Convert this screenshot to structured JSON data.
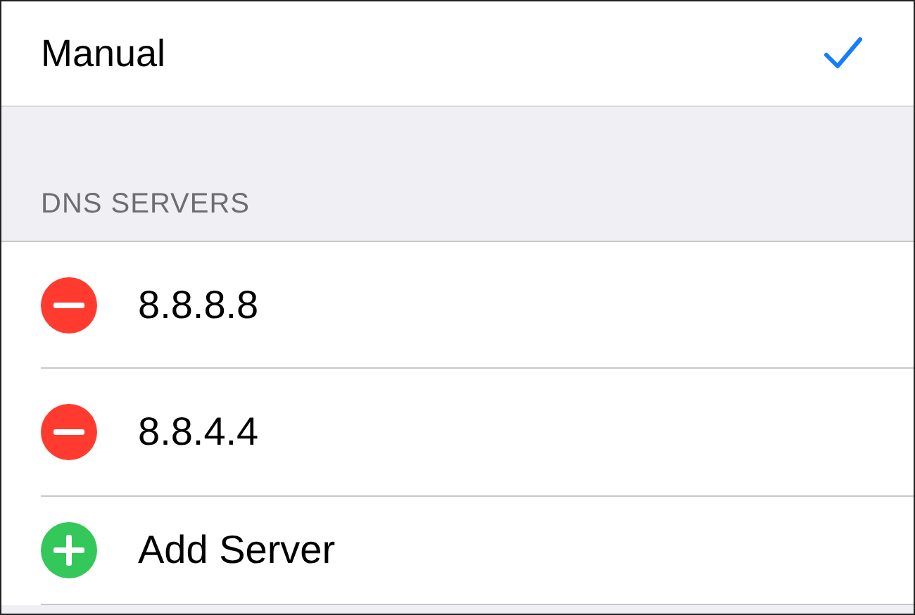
{
  "mode_options": [
    {
      "label": "Manual",
      "selected": true
    }
  ],
  "dns_section": {
    "header": "DNS SERVERS",
    "rows": [
      {
        "kind": "remove",
        "label": "8.8.8.8"
      },
      {
        "kind": "remove",
        "label": "8.8.4.4"
      },
      {
        "kind": "add",
        "label": "Add Server"
      }
    ]
  }
}
